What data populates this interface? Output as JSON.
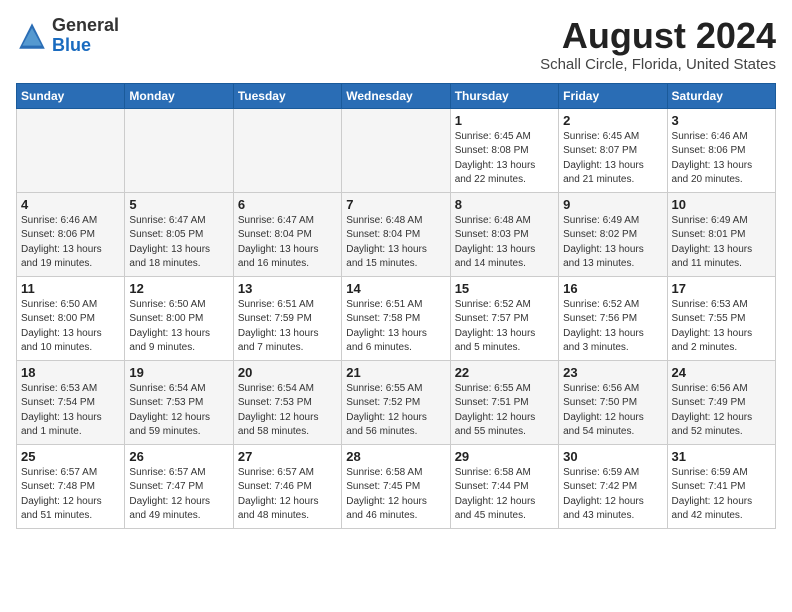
{
  "logo": {
    "general": "General",
    "blue": "Blue"
  },
  "title": "August 2024",
  "location": "Schall Circle, Florida, United States",
  "days_of_week": [
    "Sunday",
    "Monday",
    "Tuesday",
    "Wednesday",
    "Thursday",
    "Friday",
    "Saturday"
  ],
  "weeks": [
    [
      {
        "day": "",
        "info": ""
      },
      {
        "day": "",
        "info": ""
      },
      {
        "day": "",
        "info": ""
      },
      {
        "day": "",
        "info": ""
      },
      {
        "day": "1",
        "info": "Sunrise: 6:45 AM\nSunset: 8:08 PM\nDaylight: 13 hours\nand 22 minutes."
      },
      {
        "day": "2",
        "info": "Sunrise: 6:45 AM\nSunset: 8:07 PM\nDaylight: 13 hours\nand 21 minutes."
      },
      {
        "day": "3",
        "info": "Sunrise: 6:46 AM\nSunset: 8:06 PM\nDaylight: 13 hours\nand 20 minutes."
      }
    ],
    [
      {
        "day": "4",
        "info": "Sunrise: 6:46 AM\nSunset: 8:06 PM\nDaylight: 13 hours\nand 19 minutes."
      },
      {
        "day": "5",
        "info": "Sunrise: 6:47 AM\nSunset: 8:05 PM\nDaylight: 13 hours\nand 18 minutes."
      },
      {
        "day": "6",
        "info": "Sunrise: 6:47 AM\nSunset: 8:04 PM\nDaylight: 13 hours\nand 16 minutes."
      },
      {
        "day": "7",
        "info": "Sunrise: 6:48 AM\nSunset: 8:04 PM\nDaylight: 13 hours\nand 15 minutes."
      },
      {
        "day": "8",
        "info": "Sunrise: 6:48 AM\nSunset: 8:03 PM\nDaylight: 13 hours\nand 14 minutes."
      },
      {
        "day": "9",
        "info": "Sunrise: 6:49 AM\nSunset: 8:02 PM\nDaylight: 13 hours\nand 13 minutes."
      },
      {
        "day": "10",
        "info": "Sunrise: 6:49 AM\nSunset: 8:01 PM\nDaylight: 13 hours\nand 11 minutes."
      }
    ],
    [
      {
        "day": "11",
        "info": "Sunrise: 6:50 AM\nSunset: 8:00 PM\nDaylight: 13 hours\nand 10 minutes."
      },
      {
        "day": "12",
        "info": "Sunrise: 6:50 AM\nSunset: 8:00 PM\nDaylight: 13 hours\nand 9 minutes."
      },
      {
        "day": "13",
        "info": "Sunrise: 6:51 AM\nSunset: 7:59 PM\nDaylight: 13 hours\nand 7 minutes."
      },
      {
        "day": "14",
        "info": "Sunrise: 6:51 AM\nSunset: 7:58 PM\nDaylight: 13 hours\nand 6 minutes."
      },
      {
        "day": "15",
        "info": "Sunrise: 6:52 AM\nSunset: 7:57 PM\nDaylight: 13 hours\nand 5 minutes."
      },
      {
        "day": "16",
        "info": "Sunrise: 6:52 AM\nSunset: 7:56 PM\nDaylight: 13 hours\nand 3 minutes."
      },
      {
        "day": "17",
        "info": "Sunrise: 6:53 AM\nSunset: 7:55 PM\nDaylight: 13 hours\nand 2 minutes."
      }
    ],
    [
      {
        "day": "18",
        "info": "Sunrise: 6:53 AM\nSunset: 7:54 PM\nDaylight: 13 hours\nand 1 minute."
      },
      {
        "day": "19",
        "info": "Sunrise: 6:54 AM\nSunset: 7:53 PM\nDaylight: 12 hours\nand 59 minutes."
      },
      {
        "day": "20",
        "info": "Sunrise: 6:54 AM\nSunset: 7:53 PM\nDaylight: 12 hours\nand 58 minutes."
      },
      {
        "day": "21",
        "info": "Sunrise: 6:55 AM\nSunset: 7:52 PM\nDaylight: 12 hours\nand 56 minutes."
      },
      {
        "day": "22",
        "info": "Sunrise: 6:55 AM\nSunset: 7:51 PM\nDaylight: 12 hours\nand 55 minutes."
      },
      {
        "day": "23",
        "info": "Sunrise: 6:56 AM\nSunset: 7:50 PM\nDaylight: 12 hours\nand 54 minutes."
      },
      {
        "day": "24",
        "info": "Sunrise: 6:56 AM\nSunset: 7:49 PM\nDaylight: 12 hours\nand 52 minutes."
      }
    ],
    [
      {
        "day": "25",
        "info": "Sunrise: 6:57 AM\nSunset: 7:48 PM\nDaylight: 12 hours\nand 51 minutes."
      },
      {
        "day": "26",
        "info": "Sunrise: 6:57 AM\nSunset: 7:47 PM\nDaylight: 12 hours\nand 49 minutes."
      },
      {
        "day": "27",
        "info": "Sunrise: 6:57 AM\nSunset: 7:46 PM\nDaylight: 12 hours\nand 48 minutes."
      },
      {
        "day": "28",
        "info": "Sunrise: 6:58 AM\nSunset: 7:45 PM\nDaylight: 12 hours\nand 46 minutes."
      },
      {
        "day": "29",
        "info": "Sunrise: 6:58 AM\nSunset: 7:44 PM\nDaylight: 12 hours\nand 45 minutes."
      },
      {
        "day": "30",
        "info": "Sunrise: 6:59 AM\nSunset: 7:42 PM\nDaylight: 12 hours\nand 43 minutes."
      },
      {
        "day": "31",
        "info": "Sunrise: 6:59 AM\nSunset: 7:41 PM\nDaylight: 12 hours\nand 42 minutes."
      }
    ]
  ]
}
